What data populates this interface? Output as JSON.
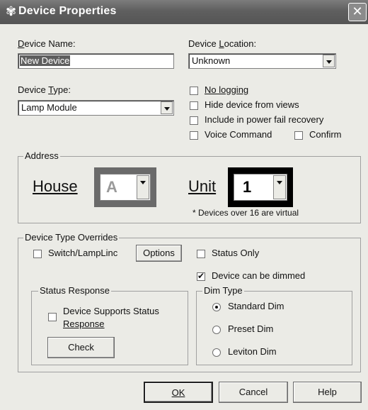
{
  "window": {
    "title": "Device Properties",
    "close_glyph": "✕"
  },
  "device_name": {
    "label": "Device Name:",
    "value": "New Device"
  },
  "device_location": {
    "label": "Device Location:",
    "value": "Unknown"
  },
  "device_type": {
    "label": "Device Type:",
    "value": "Lamp Module"
  },
  "options": {
    "no_logging": {
      "label": "No logging",
      "checked": false
    },
    "hide_from_views": {
      "label": "Hide device from views",
      "checked": false
    },
    "power_fail": {
      "label": "Include in power fail recovery",
      "checked": false
    },
    "voice_command": {
      "label": "Voice Command",
      "checked": false
    },
    "confirm": {
      "label": "Confirm",
      "checked": false
    }
  },
  "address": {
    "title": "Address",
    "house_label": "House",
    "house_value": "A",
    "unit_label": "Unit",
    "unit_value": "1",
    "note": "* Devices over 16 are virtual"
  },
  "overrides": {
    "title": "Device Type Overrides",
    "switch_lamplinc": {
      "label": "Switch/LampLinc",
      "checked": false
    },
    "options_button": "Options",
    "status_only": {
      "label": "Status Only",
      "checked": false
    },
    "can_be_dimmed": {
      "label": "Device can be dimmed",
      "checked": true
    }
  },
  "status_response": {
    "title": "Status Response",
    "supports_line1": "Device Supports Status",
    "supports_line2": "Response",
    "checked": false,
    "check_button": "Check"
  },
  "dim_type": {
    "title": "Dim Type",
    "options": [
      {
        "label": "Standard Dim",
        "selected": true
      },
      {
        "label": "Preset Dim",
        "selected": false
      },
      {
        "label": "Leviton Dim",
        "selected": false
      }
    ]
  },
  "buttons": {
    "ok": "OK",
    "cancel": "Cancel",
    "help": "Help"
  }
}
